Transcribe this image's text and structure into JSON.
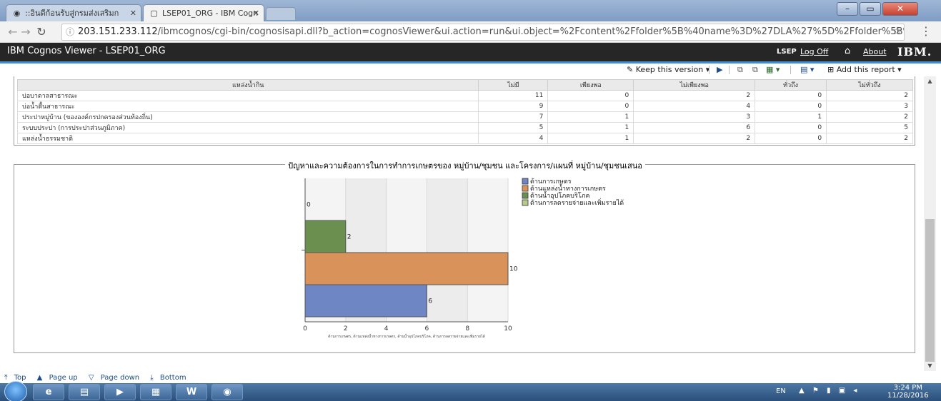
{
  "browser": {
    "tabs": [
      {
        "label": "::อินดีก้อนรับสู่กรมส่งเสริมก"
      },
      {
        "label": "LSEP01_ORG - IBM Cogn"
      }
    ],
    "url_host": "203.151.233.112",
    "url_path": "/ibmcognos/cgi-bin/cognosisapi.dll?b_action=cognosViewer&ui.action=run&ui.object=%2Fcontent%2Ffolder%5B%40name%3D%27DLA%27%5D%2Ffolder%5B%40name%3D"
  },
  "cognos": {
    "title": "IBM Cognos Viewer - LSEP01_ORG",
    "user": "LSEP",
    "logoff": "Log Off",
    "about": "About",
    "brand": "IBM."
  },
  "toolbar": {
    "keep_version": "Keep this version ▾",
    "add_report": "Add this report ▾"
  },
  "table": {
    "headers": [
      "แหล่งน้ำกิน",
      "ไม่มี",
      "เพียงพอ",
      "ไม่เพียงพอ",
      "ทั่วถึง",
      "ไม่ทั่วถึง"
    ],
    "rows": [
      {
        "label": "บ่อบาดาลสาธารณะ",
        "values": [
          "11",
          "0",
          "2",
          "0",
          "2"
        ]
      },
      {
        "label": "บ่อน้ำตื้นสาธารณะ",
        "values": [
          "9",
          "0",
          "4",
          "0",
          "3"
        ]
      },
      {
        "label": "ประปาหมู่บ้าน (ขององค์กรปกครองส่วนท้องถิ่น)",
        "values": [
          "7",
          "1",
          "3",
          "1",
          "2"
        ]
      },
      {
        "label": "ระบบประปา (การประปาส่วนภูมิภาค)",
        "values": [
          "5",
          "1",
          "6",
          "0",
          "5"
        ]
      },
      {
        "label": "แหล่งน้ำธรรมชาติ",
        "values": [
          "4",
          "1",
          "2",
          "0",
          "2"
        ]
      }
    ]
  },
  "chart_data": {
    "type": "bar",
    "orientation": "horizontal",
    "title": "ปัญหาและความต้องการในการทำการเกษตรของ หมู่บ้าน/ชุมชน และโครงการ/แผนที่ หมู่บ้าน/ชุมชนเสนอ",
    "xlabel": "ด้านการเกษตร, ด้านแหล่งน้ำทางการเกษตร, ด้านน้ำอุปโภคบริโภค, ด้านการลดรายจ่ายและเพิ่มรายได้",
    "xlim": [
      0,
      10
    ],
    "xticks": [
      "0",
      "2",
      "4",
      "6",
      "8",
      "10"
    ],
    "grid": true,
    "legend_position": "right",
    "series": [
      {
        "name": "ด้านการเกษตร",
        "value": 6,
        "color": "#6f86c4"
      },
      {
        "name": "ด้านแหล่งน้ำทางการเกษตร",
        "value": 10,
        "color": "#d9925a"
      },
      {
        "name": "ด้านน้ำอุปโภคบริโภค",
        "value": 2,
        "color": "#6b8f4e"
      },
      {
        "name": "ด้านการลดรายจ่ายและเพิ่มรายได้",
        "value": 0,
        "color": "#b7c98a"
      }
    ]
  },
  "paging": {
    "top": "Top",
    "page_up": "Page up",
    "page_down": "Page down",
    "bottom": "Bottom"
  },
  "taskbar": {
    "lang": "EN",
    "time": "3:24 PM",
    "date": "11/28/2016"
  }
}
